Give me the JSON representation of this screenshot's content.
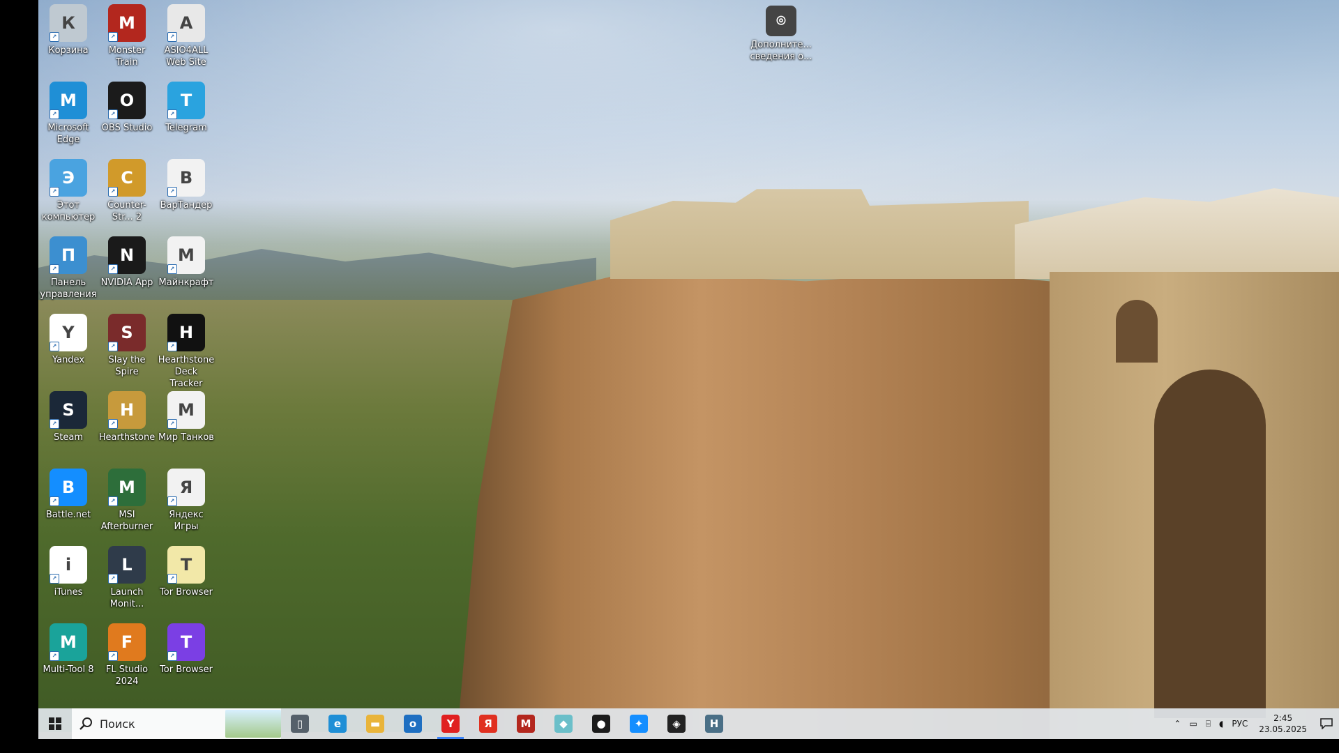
{
  "desktop": {
    "icons": [
      {
        "label": "Корзина",
        "icon": "recycle-bin-icon",
        "color": "#bfc9d1"
      },
      {
        "label": "Monster Train",
        "icon": "monster-train-icon",
        "color": "#b3271e"
      },
      {
        "label": "ASIO4ALL Web Site",
        "icon": "asio4all-icon",
        "color": "#e8e8e8"
      },
      {
        "label": "Microsoft Edge",
        "icon": "edge-icon",
        "color": "#1f8fd6"
      },
      {
        "label": "OBS Studio",
        "icon": "obs-icon",
        "color": "#1b1b1b"
      },
      {
        "label": "Telegram",
        "icon": "telegram-icon",
        "color": "#2aa3df"
      },
      {
        "label": "Этот компьютер",
        "icon": "this-pc-icon",
        "color": "#4aa3e0"
      },
      {
        "label": "Counter-Str... 2",
        "icon": "counter-strike-icon",
        "color": "#d19a2a"
      },
      {
        "label": "ВарТандер",
        "icon": "file-icon",
        "color": "#f2f2f2"
      },
      {
        "label": "Панель управления",
        "icon": "control-panel-icon",
        "color": "#3c8fd0"
      },
      {
        "label": "NVIDIA App",
        "icon": "nvidia-icon",
        "color": "#1a1a1a"
      },
      {
        "label": "Майнкрафт",
        "icon": "file-icon",
        "color": "#f2f2f2"
      },
      {
        "label": "Yandex",
        "icon": "yandex-browser-icon",
        "color": "#ffffff"
      },
      {
        "label": "Slay the Spire",
        "icon": "slay-the-spire-icon",
        "color": "#7a2b2b"
      },
      {
        "label": "Hearthstone Deck Tracker",
        "icon": "deck-tracker-icon",
        "color": "#111111"
      },
      {
        "label": "Steam",
        "icon": "steam-icon",
        "color": "#1b2838"
      },
      {
        "label": "Hearthstone",
        "icon": "hearthstone-icon",
        "color": "#c79a3c"
      },
      {
        "label": "Мир Танков",
        "icon": "file-icon",
        "color": "#f2f2f2"
      },
      {
        "label": "Battle.net",
        "icon": "battlenet-icon",
        "color": "#148eff"
      },
      {
        "label": "MSI Afterburner",
        "icon": "msi-afterburner-icon",
        "color": "#2d6e3a"
      },
      {
        "label": "Яндекс Игры",
        "icon": "file-icon",
        "color": "#f2f2f2"
      },
      {
        "label": "iTunes",
        "icon": "itunes-icon",
        "color": "#ffffff"
      },
      {
        "label": "Launch Monit...",
        "icon": "launch-monitor-icon",
        "color": "#2f3b4a"
      },
      {
        "label": "Tor Browser",
        "icon": "tor-browser-icon",
        "color": "#f2e8a8"
      },
      {
        "label": "Multi-Tool 8",
        "icon": "multi-tool-icon",
        "color": "#1aa39a"
      },
      {
        "label": "FL Studio 2024",
        "icon": "fl-studio-icon",
        "color": "#e07a1e"
      },
      {
        "label": "Tor Browser",
        "icon": "tor-browser-icon",
        "color": "#7b3fe4"
      }
    ],
    "extra_icon": {
      "label": "Дополните... сведения о...",
      "icon": "info-circle-icon",
      "color": "#333333"
    }
  },
  "taskbar": {
    "search_placeholder": "Поиск",
    "pinned": [
      {
        "name": "task-view",
        "icon": "task-view-icon",
        "glyph": "▯",
        "color": "#55606a",
        "active": false
      },
      {
        "name": "edge",
        "icon": "edge-icon",
        "glyph": "e",
        "color": "#1f8fd6",
        "active": false
      },
      {
        "name": "file-explorer",
        "icon": "folder-icon",
        "glyph": "▬",
        "color": "#e9b43a",
        "active": false
      },
      {
        "name": "outlook",
        "icon": "mail-icon",
        "glyph": "o",
        "color": "#1e6fc1",
        "active": false
      },
      {
        "name": "yandex-browser",
        "icon": "yandex-browser-icon",
        "glyph": "Y",
        "color": "#e02020",
        "active": true
      },
      {
        "name": "yandex",
        "icon": "yandex-icon",
        "glyph": "Я",
        "color": "#e03020",
        "active": false
      },
      {
        "name": "monster-train",
        "icon": "monster-train-icon",
        "glyph": "M",
        "color": "#b3271e",
        "active": false
      },
      {
        "name": "app-cyan",
        "icon": "app-icon",
        "glyph": "◆",
        "color": "#6bbfc9",
        "active": false
      },
      {
        "name": "obs",
        "icon": "obs-icon",
        "glyph": "●",
        "color": "#1b1b1b",
        "active": false
      },
      {
        "name": "battlenet",
        "icon": "battlenet-icon",
        "glyph": "✦",
        "color": "#148eff",
        "active": false
      },
      {
        "name": "deck-tracker",
        "icon": "deck-tracker-icon",
        "glyph": "◈",
        "color": "#222222",
        "active": false
      },
      {
        "name": "hearthstone",
        "icon": "hearthstone-icon",
        "glyph": "H",
        "color": "#4a6f86",
        "active": false
      }
    ],
    "tray": {
      "language": "РУС",
      "time": "2:45",
      "date": "23.05.2025"
    }
  }
}
